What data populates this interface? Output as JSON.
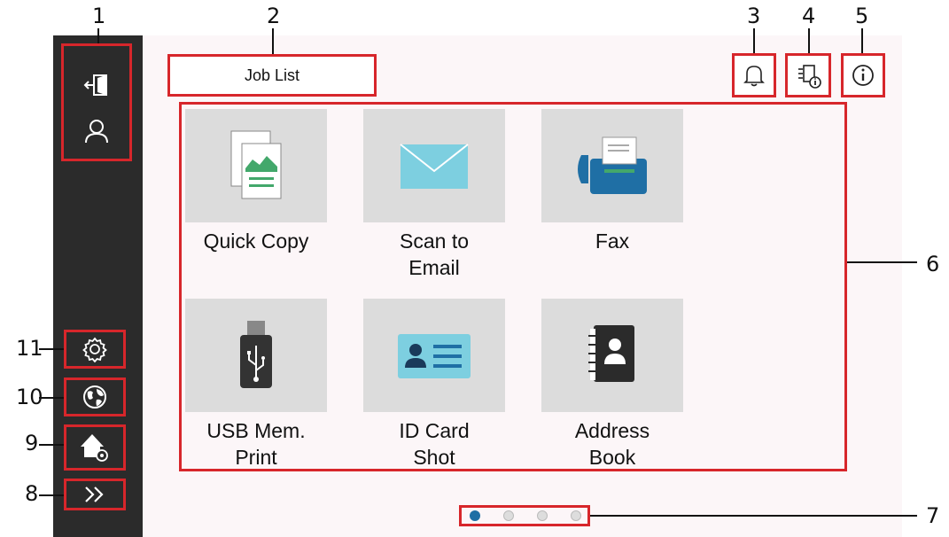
{
  "callouts": [
    "1",
    "2",
    "3",
    "4",
    "5",
    "6",
    "7",
    "8",
    "9",
    "10",
    "11"
  ],
  "header": {
    "job_list_label": "Job List"
  },
  "tiles": [
    {
      "label": "Quick Copy",
      "icon": "copy-icon"
    },
    {
      "label": "Scan to\nEmail",
      "icon": "envelope-icon"
    },
    {
      "label": "Fax",
      "icon": "fax-icon"
    },
    {
      "label": "USB Mem.\nPrint",
      "icon": "usb-icon"
    },
    {
      "label": "ID Card\nShot",
      "icon": "id-card-icon"
    },
    {
      "label": "Address\nBook",
      "icon": "address-book-icon"
    }
  ],
  "sidebar": {
    "top_icons": [
      "logout-icon",
      "user-icon"
    ],
    "bottom_icons": [
      "settings-gear-icon",
      "globe-icon",
      "home-settings-icon",
      "expand-chevrons-icon"
    ]
  },
  "top_icons": [
    "bell-icon",
    "machine-info-icon",
    "info-icon"
  ],
  "pagination": {
    "total": 4,
    "active": 1
  },
  "colors": {
    "callout_frame": "#d7262b",
    "sidebar": "#2b2b2b",
    "tile": "#dcdcdc",
    "accent_blue": "#1f6fa5",
    "accent_green": "#43a86b"
  }
}
